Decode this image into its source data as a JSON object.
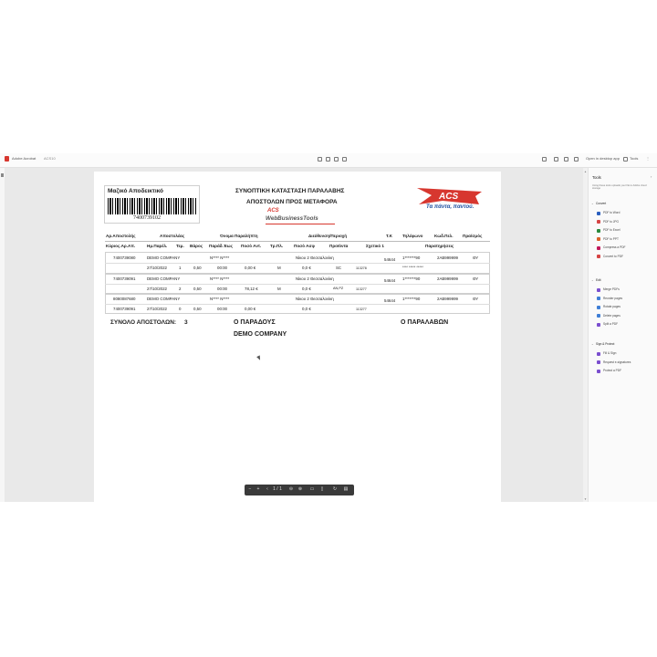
{
  "app": {
    "name": "Adobe Acrobat",
    "file_label": "ACS10",
    "open_desktop": "Open in desktop app",
    "tools_btn": "Tools"
  },
  "right_panel": {
    "title": "Tools",
    "desc": "Using these tools uploads your file to Adobe cloud storage",
    "sections": [
      {
        "name": "Convert",
        "items": [
          {
            "label": "PDF to Word",
            "icon": "word-icon",
            "color": "#2b5fbf"
          },
          {
            "label": "PDF to JPG",
            "icon": "image-icon",
            "color": "#d64545"
          },
          {
            "label": "PDF to Excel",
            "icon": "excel-icon",
            "color": "#2b8a3e"
          },
          {
            "label": "PDF to PPT",
            "icon": "ppt-icon",
            "color": "#d9602a"
          },
          {
            "label": "Compress a PDF",
            "icon": "compress-icon",
            "color": "#c2185b"
          },
          {
            "label": "Convert to PDF",
            "icon": "convert-icon",
            "color": "#d64545"
          }
        ]
      },
      {
        "name": "Edit",
        "items": [
          {
            "label": "Merge PDFs",
            "icon": "merge-icon",
            "color": "#7b4fcf"
          },
          {
            "label": "Reorder pages",
            "icon": "reorder-icon",
            "color": "#3f7fd6"
          },
          {
            "label": "Rotate pages",
            "icon": "rotate-icon",
            "color": "#3f7fd6"
          },
          {
            "label": "Delete pages",
            "icon": "delete-icon",
            "color": "#3f7fd6"
          },
          {
            "label": "Split a PDF",
            "icon": "split-icon",
            "color": "#7b4fcf"
          }
        ]
      },
      {
        "name": "Sign & Protect",
        "items": [
          {
            "label": "Fill & Sign",
            "icon": "sign-icon",
            "color": "#7b4fcf"
          },
          {
            "label": "Request e-signatures",
            "icon": "request-sign-icon",
            "color": "#7b4fcf"
          },
          {
            "label": "Protect a PDF",
            "icon": "protect-icon",
            "color": "#7b4fcf"
          }
        ]
      }
    ]
  },
  "doc": {
    "label_title": "Μαζικό Αποδεικτικό",
    "barcode_number": "7400739102",
    "title1": "ΣΥΝΟΠΤΙΚΗ ΚΑΤΑΣΤΑΣΗ ΠΑΡΑΛΑΒΗΣ",
    "title2": "ΑΠΟΣΤΟΛΩΝ ΠΡΟΣ ΜΕΤΑΦΟΡΑ",
    "logo_acs": "ACS",
    "logo_web1": "ACS",
    "logo_web2": "WebBusinessTools",
    "slogan": "Τα πάντα, παντού.",
    "headers_row1": [
      "Αρ.Αποστολής",
      "Αποστολέας",
      "Όνομα Παραλήπτη",
      "Διεύθυνση/Περιοχή",
      "Τ.Κ",
      "Τηλέφωνο",
      "Κωδ.Πελ.",
      "Πρα/σμός"
    ],
    "headers_row2": [
      "Κύριος.Αρ.Απ.",
      "Ημ.Παρέλ.",
      "Τεμ.",
      "Βάρος",
      "Παράδ.Έως",
      "Ποσό Αντ.",
      "Τρ.Πλ.",
      "Ποσό Ασφ",
      "Προϊόντα",
      "Σχετικό 1",
      "Παρατηρήσεις"
    ],
    "rows": [
      {
        "id": "7400739080",
        "sender": "DEMO COMPANY",
        "recipient": "N**** N****",
        "address": "Νίκου 2 Θεσσαλονίκη",
        "zip": "54644",
        "phone": "1*******90",
        "customer": "2AB999999",
        "dest": "ΘΥ",
        "date": "27/10/2022",
        "pieces": "1",
        "weight": "0,50",
        "until": "00:00",
        "cod": "0,00 €",
        "pay": "M",
        "insurance": "0,0 €",
        "product": "SC",
        "rel": "113278",
        "remarks": "**** ***** *****"
      },
      {
        "id": "7400739091",
        "sender": "DEMO COMPANY",
        "recipient": "N**** N****",
        "address": "Νίκου 2 Θεσσαλονίκη",
        "zip": "54644",
        "phone": "1*******90",
        "customer": "2AB999999",
        "dest": "ΘΥ",
        "date": "27/10/2022",
        "pieces": "2",
        "weight": "0,50",
        "until": "00:00",
        "cod": "78,12 €",
        "pay": "M",
        "insurance": "0,0 €",
        "product": "AN,PZ",
        "rel": "113277",
        "remarks": ""
      },
      {
        "id": "8080087680",
        "sender": "DEMO COMPANY",
        "recipient": "N**** N****",
        "address": "Νίκου 2 Θεσσαλονίκη",
        "zip": "54644",
        "phone": "1*******90",
        "customer": "2AB999999",
        "dest": "ΘΥ",
        "date": "",
        "pieces": "",
        "weight": "",
        "until": "",
        "cod": "",
        "pay": "",
        "insurance": "",
        "product": "",
        "rel": "",
        "remarks": "",
        "sub_id": "7400739091",
        "sub_date": "27/10/2022",
        "sub_pieces": "0",
        "sub_weight": "0,50",
        "sub_until": "00:00",
        "sub_cod": "0,00 €",
        "sub_insurance": "0,0 €",
        "sub_rel": "113277"
      }
    ],
    "total_label": "ΣΥΝΟΛΟ ΑΠΟΣΤΟΛΩΝ:",
    "total_value": "3",
    "deliverer": "Ο ΠΑΡΑΔΟΥΣ",
    "company": "DEMO COMPANY",
    "receiver": "Ο ΠΑΡΑΛΑΒΩΝ"
  }
}
